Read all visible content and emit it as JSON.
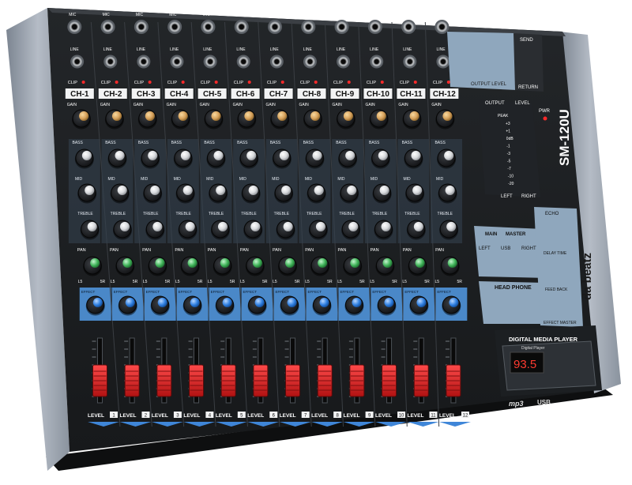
{
  "product": {
    "model": "SM-120U",
    "brand": "da beatz"
  },
  "channels": [
    {
      "name": "CH-1",
      "level_num": "1"
    },
    {
      "name": "CH-2",
      "level_num": "2"
    },
    {
      "name": "CH-3",
      "level_num": "3"
    },
    {
      "name": "CH-4",
      "level_num": "4"
    },
    {
      "name": "CH-5",
      "level_num": "5"
    },
    {
      "name": "CH-6",
      "level_num": "6"
    },
    {
      "name": "CH-7",
      "level_num": "7"
    },
    {
      "name": "CH-8",
      "level_num": "8"
    },
    {
      "name": "CH-9",
      "level_num": "9"
    },
    {
      "name": "CH-10",
      "level_num": "10"
    },
    {
      "name": "CH-11",
      "level_num": "11"
    },
    {
      "name": "CH-12",
      "level_num": "12"
    }
  ],
  "strip_labels": {
    "mic": "MIC",
    "line": "LINE",
    "clip": "CLIP",
    "gain": "GAIN",
    "bass": "BASS",
    "mid": "MID",
    "treble": "TREBLE",
    "pan": "PAN",
    "pan_left": "L5",
    "pan_right": "5R",
    "effect": "EFFECT",
    "level": "LEVEL"
  },
  "io_labels": {
    "output_level": "OUTPUT LEVEL",
    "send": "SEND",
    "return": "RETURN"
  },
  "meter": {
    "output": "OUTPUT",
    "level": "LEVEL",
    "pwr": "PWR",
    "peak": "PEAK",
    "scale": [
      "+3",
      "+1",
      "0dB",
      "-1",
      "-3",
      "-5",
      "-7",
      "-10",
      "-20"
    ],
    "left": "LEFT",
    "right": "RIGHT"
  },
  "master": {
    "main": "MAIN",
    "master": "MASTER",
    "left": "LEFT",
    "usb": "USB",
    "right": "RIGHT",
    "head_phone": "HEAD PHONE"
  },
  "effects": {
    "echo": "ECHO",
    "delay_time": "DELAY TIME",
    "feed_back": "FEED BACK",
    "effect_master": "EFFECT MASTER"
  },
  "player": {
    "title": "DIGITAL MEDIA PLAYER",
    "subtitle": "Digital Player",
    "display": "93.5",
    "mp3": "mp3",
    "usb": "USB"
  }
}
